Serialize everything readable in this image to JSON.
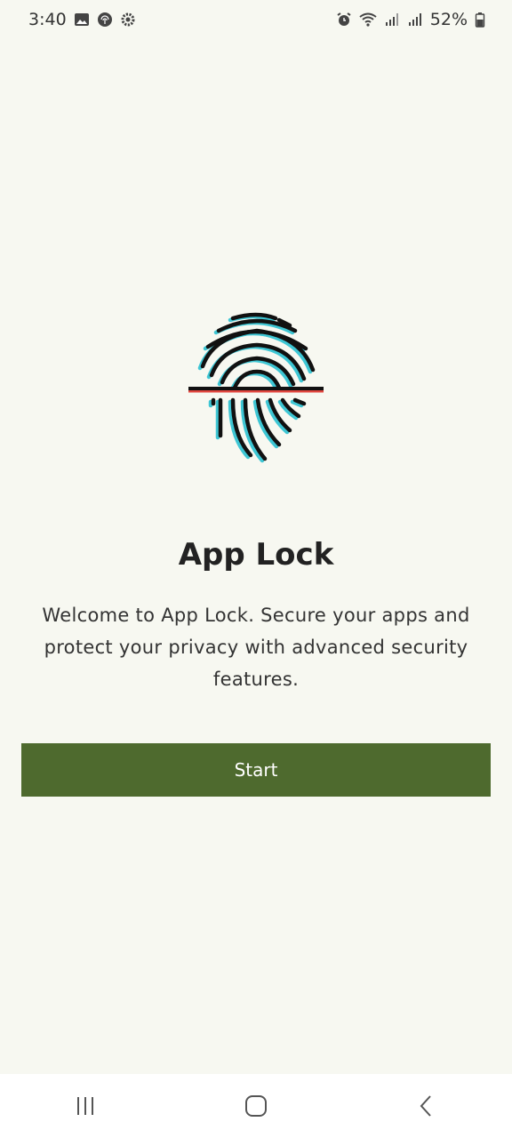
{
  "status_bar": {
    "time": "3:40",
    "battery": "52%",
    "left_icons": [
      "image-icon",
      "fingerprint-icon",
      "settings-icon"
    ],
    "right_icons": [
      "alarm-icon",
      "wifi-icon",
      "signal-icon",
      "signal-icon",
      "battery-icon"
    ]
  },
  "main": {
    "title": "App Lock",
    "description": "Welcome to App Lock. Secure your apps and protect your privacy with advanced security features.",
    "start_label": "Start"
  },
  "colors": {
    "background": "#f7f8f1",
    "button": "#4e6a2e",
    "scan_line": "#e0463e",
    "accent_cyan": "#3ec6d4"
  },
  "nav_bar": {
    "icons": [
      "recent-apps-icon",
      "home-icon",
      "back-icon"
    ]
  }
}
